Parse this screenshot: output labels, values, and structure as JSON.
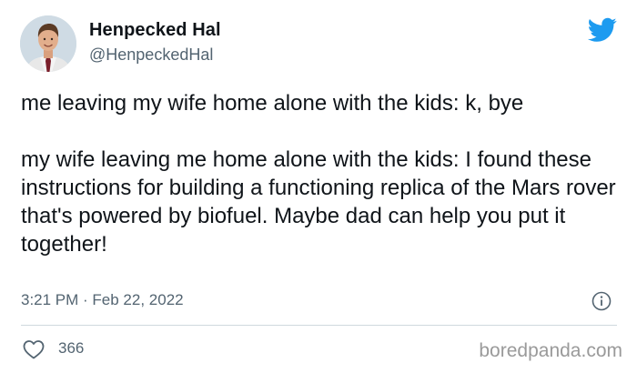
{
  "author": {
    "display_name": "Henpecked Hal",
    "handle": "@HenpeckedHal",
    "avatar_icon": "profile-photo"
  },
  "brand_icon": "twitter-bird-icon",
  "tweet": {
    "paragraph_1": "me leaving my wife home alone with the kids: k, bye",
    "paragraph_2": "my wife leaving me home alone with the kids: I found these instructions for building a functioning replica of the Mars rover that's powered by biofuel. Maybe dad can help you put it together!",
    "timestamp": "3:21 PM · Feb 22, 2022"
  },
  "engagement": {
    "like_count": "366",
    "like_icon": "heart-icon",
    "info_icon": "info-icon"
  },
  "watermark": "boredpanda.com",
  "colors": {
    "twitter_blue": "#1d9bf0",
    "text_primary": "#0f1419",
    "text_secondary": "#536471",
    "divider": "#cfd9de"
  }
}
